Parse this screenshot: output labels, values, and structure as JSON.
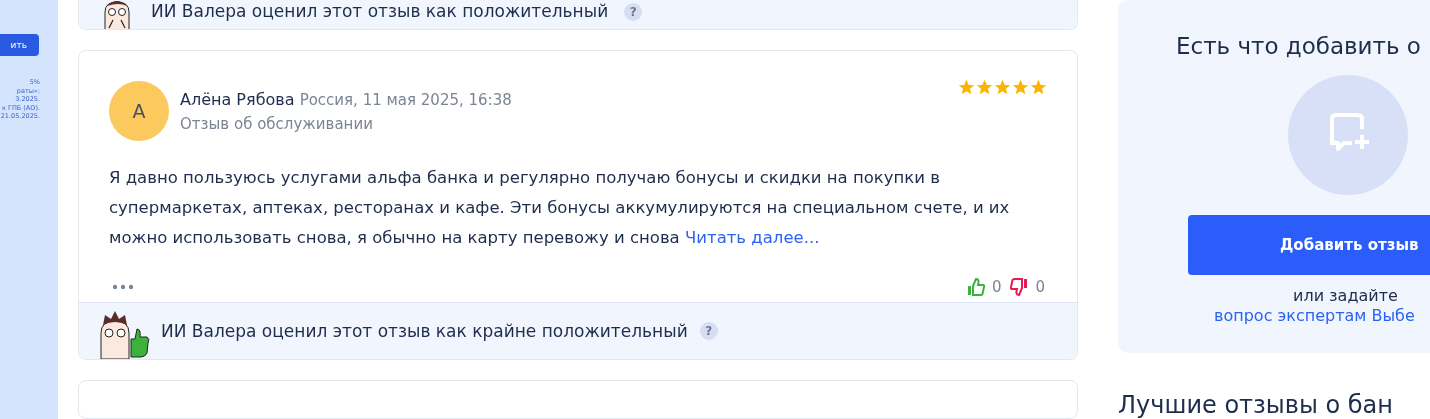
{
  "side_banner": {
    "button": "ить",
    "lines": [
      "5%",
      "раты»:",
      "3.2025.",
      "к ГПБ (АО).",
      "21.05.2025."
    ]
  },
  "previous_review": {
    "ai_verdict": "ИИ Валера оценил этот отзыв как положительный",
    "help": "?"
  },
  "review": {
    "avatar_letter": "А",
    "author": "Алёна Рябова",
    "meta": "Россия, 11 мая 2025, 16:38",
    "category": "Отзыв об обслуживании",
    "stars": 5,
    "text": "Я давно пользуюсь услугами альфа банка и регулярно получаю бонусы и скидки на покупки в супермаркетах, аптеках, ресторанах и кафе. Эти бонусы аккумулируются на специальном счете, и их можно использовать снова, я обычно на карту перевожу и снова",
    "read_more": "Читать далее...",
    "likes": "0",
    "dislikes": "0",
    "ai_verdict": "ИИ Валера оценил этот отзыв как крайне положительный",
    "help": "?"
  },
  "add_panel": {
    "title": "Есть что добавить о",
    "button": "Добавить отзыв",
    "or_text": "или задайте",
    "link": "вопрос экспертам Выбе"
  },
  "next_heading": "Лучшие отзывы о бан"
}
